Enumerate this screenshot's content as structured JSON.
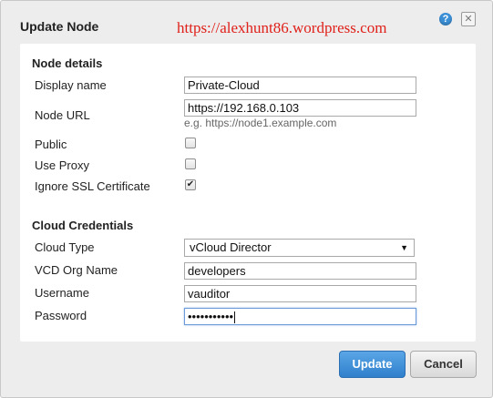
{
  "dialog": {
    "title": "Update Node",
    "watermark": "https://alexhunt86.wordpress.com",
    "help_icon": "?",
    "close_icon": "✕"
  },
  "node_details": {
    "heading": "Node details",
    "display_name_label": "Display name",
    "display_name_value": "Private-Cloud",
    "node_url_label": "Node URL",
    "node_url_value": "https://192.168.0.103",
    "node_url_hint": "e.g. https://node1.example.com",
    "public_label": "Public",
    "public_checked": false,
    "use_proxy_label": "Use Proxy",
    "use_proxy_checked": false,
    "ignore_ssl_label": "Ignore SSL Certificate",
    "ignore_ssl_checked": true,
    "checkmark": "✔"
  },
  "cloud_credentials": {
    "heading": "Cloud Credentials",
    "cloud_type_label": "Cloud Type",
    "cloud_type_value": "vCloud Director",
    "cloud_type_caret": "▼",
    "vcd_org_label": "VCD Org Name",
    "vcd_org_value": "developers",
    "username_label": "Username",
    "username_value": "vauditor",
    "password_label": "Password",
    "password_value": "•••••••••••"
  },
  "buttons": {
    "update": "Update",
    "cancel": "Cancel"
  },
  "colors": {
    "accent": "#2f7fcc",
    "watermark": "#e0201a"
  }
}
